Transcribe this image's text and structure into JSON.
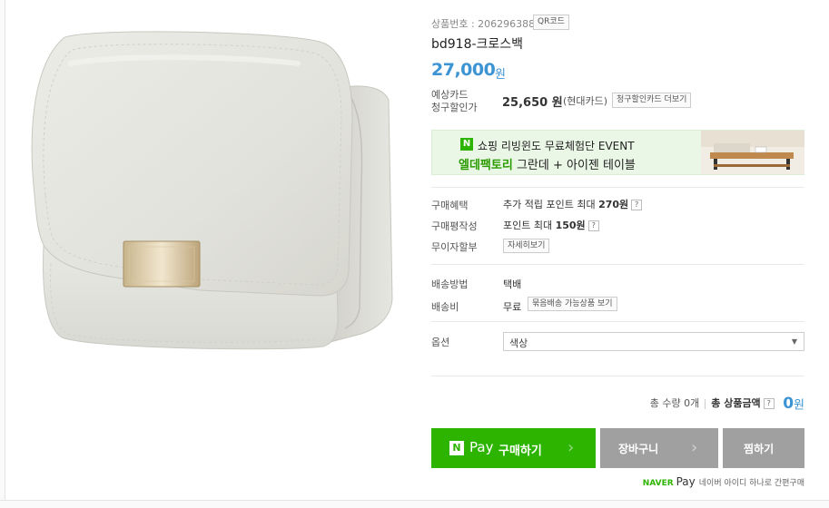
{
  "product": {
    "number_label": "상품번호 : 2062963882",
    "qr_label": "QR코드",
    "name": "bd918-크로스백",
    "price": "27,000",
    "price_unit": "원"
  },
  "card_discount": {
    "label_line1": "예상카드",
    "label_line2": "청구할인가",
    "price": "25,650 원",
    "card": "(현대카드)",
    "button": "청구할인카드 더보기"
  },
  "banner": {
    "badge": "N",
    "line1": "쇼핑 리빙윈도 무료체험단 EVENT",
    "line2_green": "엘데팩토리",
    "line2_rest": " 그란데 + 아이젠 테이블"
  },
  "benefits": [
    {
      "label": "구매혜택",
      "prefix": "추가 적립 포인트 최대 ",
      "bold": "270원",
      "help": "?"
    },
    {
      "label": "구매평작성",
      "prefix": "포인트 최대 ",
      "bold": "150원",
      "help": "?"
    }
  ],
  "installment": {
    "label": "무이자할부",
    "button": "자세히보기"
  },
  "shipping": {
    "method_label": "배송방법",
    "method_value": "택배",
    "fee_label": "배송비",
    "fee_value": "무료",
    "fee_button": "묶음배송 가능상품 보기"
  },
  "option": {
    "label": "옵션",
    "value": "색상"
  },
  "total": {
    "qty": "총 수량 0개",
    "label": "총 상품금액",
    "help": "?",
    "amount": "0",
    "unit": "원"
  },
  "buttons": {
    "buy_n": "N",
    "buy_pay": "Pay",
    "buy_label": "구매하기",
    "cart": "장바구니",
    "wish": "찜하기"
  },
  "naverpay": {
    "brand": "NAVER",
    "pay": "Pay",
    "note": "네이버 아이디 하나로 간편구매"
  },
  "colors": {
    "accent_blue": "#3c94d3",
    "naver_green": "#2db400",
    "button_gray": "#a0a0a0"
  }
}
